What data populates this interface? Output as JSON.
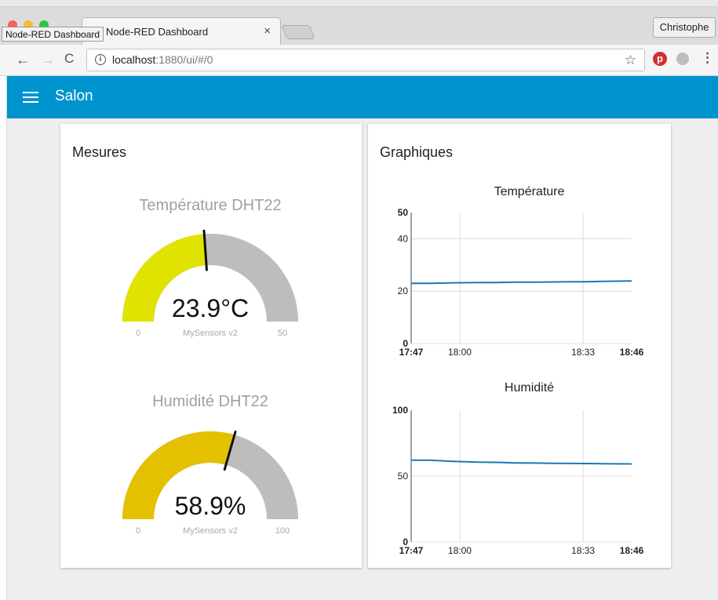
{
  "browser": {
    "tab_title": "Node-RED Dashboard",
    "tab_close": "×",
    "tooltip": "Node-RED Dashboard",
    "profile": "Christophe",
    "url_host": "localhost",
    "url_path": ":1880/ui/#/0",
    "icons": {
      "back": "←",
      "forward": "→",
      "reload": "C",
      "info": "i",
      "star": "☆",
      "pinterest": "p",
      "menu": "⋮"
    }
  },
  "dashboard": {
    "title": "Salon",
    "accent_color": "#0094ce",
    "groups": {
      "mesures": "Mesures",
      "graphiques": "Graphiques"
    }
  },
  "gauges": [
    {
      "title": "Température DHT22",
      "value_text": "23.9°C",
      "value": 23.9,
      "min": 0,
      "max": 50,
      "min_label": "0",
      "max_label": "50",
      "label": "MySensors v2",
      "color": "#e0e300"
    },
    {
      "title": "Humidité DHT22",
      "value_text": "58.9%",
      "value": 58.9,
      "min": 0,
      "max": 100,
      "min_label": "0",
      "max_label": "100",
      "label": "MySensors v2",
      "color": "#e3c000"
    }
  ],
  "chart_data": [
    {
      "type": "line",
      "title": "Température",
      "ylim": [
        0,
        50
      ],
      "y_ticks": [
        "50",
        "40",
        "20",
        "0"
      ],
      "x_ticks": [
        "17:47",
        "18:00",
        "18:33",
        "18:46"
      ],
      "grid": true,
      "line_color": "#1f77b4",
      "series": [
        {
          "x": [
            "17:47",
            "17:52",
            "17:57",
            "18:00",
            "18:05",
            "18:10",
            "18:15",
            "18:20",
            "18:25",
            "18:30",
            "18:33",
            "18:38",
            "18:42",
            "18:46"
          ],
          "values": [
            23.0,
            23.0,
            23.1,
            23.2,
            23.3,
            23.3,
            23.4,
            23.4,
            23.5,
            23.6,
            23.6,
            23.7,
            23.8,
            23.9
          ]
        }
      ]
    },
    {
      "type": "line",
      "title": "Humidité",
      "ylim": [
        0,
        100
      ],
      "y_ticks": [
        "100",
        "50",
        "0"
      ],
      "x_ticks": [
        "17:47",
        "18:00",
        "18:33",
        "18:46"
      ],
      "grid": true,
      "line_color": "#1f77b4",
      "series": [
        {
          "x": [
            "17:47",
            "17:52",
            "17:57",
            "18:00",
            "18:05",
            "18:10",
            "18:15",
            "18:20",
            "18:25",
            "18:30",
            "18:33",
            "18:38",
            "18:42",
            "18:46"
          ],
          "values": [
            62.0,
            62.1,
            61.3,
            61.0,
            60.6,
            60.4,
            60.0,
            59.9,
            59.7,
            59.6,
            59.5,
            59.4,
            59.3,
            59.2
          ]
        }
      ]
    }
  ]
}
